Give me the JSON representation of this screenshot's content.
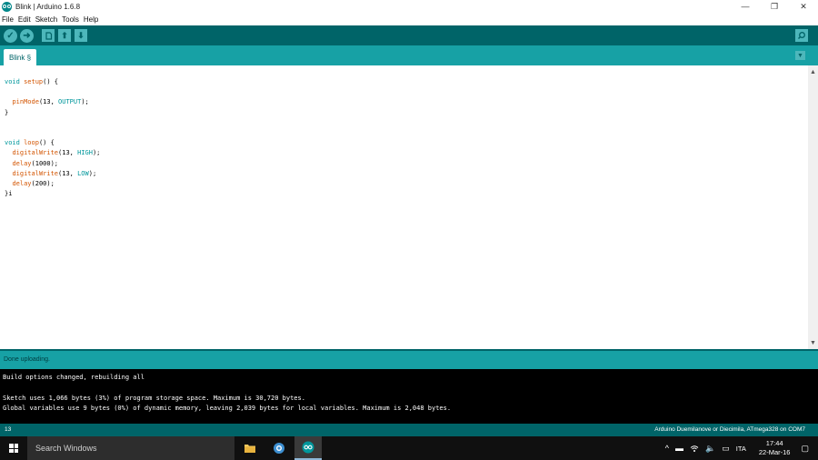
{
  "window": {
    "title": "Blink | Arduino 1.6.8",
    "controls": {
      "minimize": "—",
      "maximize": "❐",
      "close": "✕"
    }
  },
  "menu": {
    "items": [
      "File",
      "Edit",
      "Sketch",
      "Tools",
      "Help"
    ]
  },
  "toolbar": {
    "verify_icon": "check-icon",
    "upload_icon": "arrow-right-icon",
    "new_icon": "new-file-icon",
    "open_icon": "arrow-up-icon",
    "save_icon": "arrow-down-icon",
    "serial_monitor_icon": "magnifier-icon"
  },
  "tabs": {
    "items": [
      {
        "label": "Blink §"
      }
    ],
    "menu_icon": "triangle-down-icon"
  },
  "editor": {
    "code": [
      {
        "t": "void setup() {"
      },
      {
        "t": ""
      },
      {
        "t": "  pinMode(13, OUTPUT);"
      },
      {
        "t": "}"
      },
      {
        "t": ""
      },
      {
        "t": ""
      },
      {
        "t": "void loop() {"
      },
      {
        "t": "  digitalWrite(13, HIGH);"
      },
      {
        "t": "  delay(1000);"
      },
      {
        "t": "  digitalWrite(13, LOW);"
      },
      {
        "t": "  delay(200);"
      },
      {
        "t": "}i"
      }
    ]
  },
  "status": {
    "message": "Done uploading."
  },
  "console": {
    "lines": [
      "Build options changed, rebuilding all",
      "",
      "Sketch uses 1,066 bytes (3%) of program storage space. Maximum is 30,720 bytes.",
      "Global variables use 9 bytes (0%) of dynamic memory, leaving 2,039 bytes for local variables. Maximum is 2,048 bytes."
    ]
  },
  "footer": {
    "line_number": "13",
    "board": "Arduino Duemilanove or Diecimila, ATmega328 on COM7"
  },
  "taskbar": {
    "search_placeholder": "Search Windows",
    "language": "ITA",
    "time": "17:44",
    "date": "22-Mar-16"
  },
  "colors": {
    "toolbar": "#006468",
    "tabbar": "#17a1a5",
    "console": "#000000",
    "keyword": "#00979c",
    "function": "#d35400"
  }
}
